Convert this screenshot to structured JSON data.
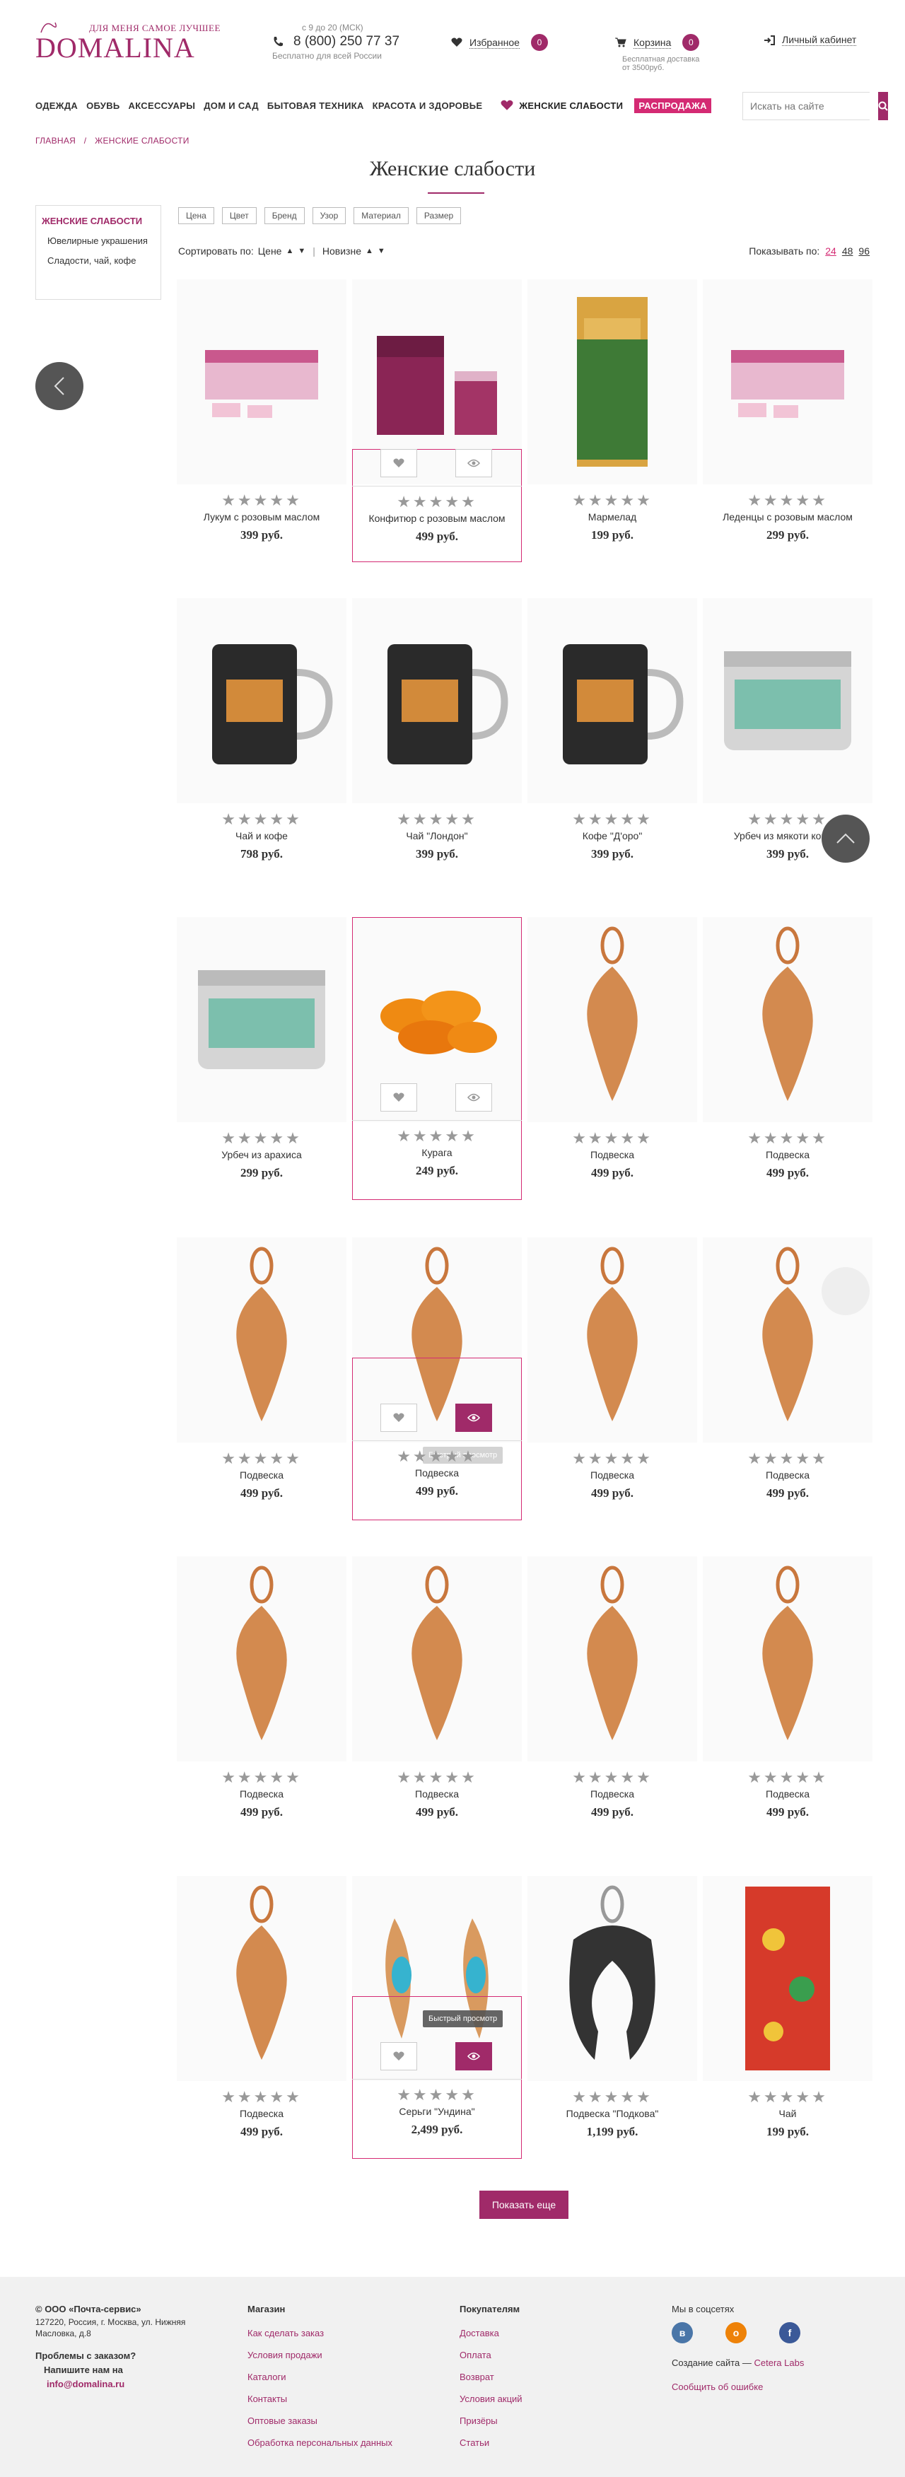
{
  "header": {
    "logo_tagline": "ДЛЯ МЕНЯ САМОЕ ЛУЧШЕЕ",
    "logo_text": "DOMALINA",
    "hours": "с 9 до 20 (МСК)",
    "phone": "8 (800) 250 77 37",
    "phone_sub": "Бесплатно для всей России",
    "favorites_label": "Избранное",
    "favorites_count": "0",
    "cart_label": "Корзина",
    "cart_count": "0",
    "cart_sub": "Бесплатная доставка от 3500руб.",
    "account_label": "Личный кабинет"
  },
  "nav": {
    "items": [
      "ОДЕЖДА",
      "ОБУВЬ",
      "АКСЕССУАРЫ",
      "ДОМ И САД",
      "БЫТОВАЯ ТЕХНИКА",
      "КРАСОТА И ЗДОРОВЬЕ"
    ],
    "women": "ЖЕНСКИЕ СЛАБОСТИ",
    "sale": "РАСПРОДАЖА",
    "search_placeholder": "Искать на сайте"
  },
  "breadcrumb": [
    "ГЛАВНАЯ",
    "/",
    "ЖЕНСКИЕ СЛАБОСТИ"
  ],
  "page_title": "Женские слабости",
  "sidebar": [
    "ЖЕНСКИЕ СЛАБОСТИ",
    "Ювелирные украшения",
    "Сладости, чай, кофе"
  ],
  "filters": [
    "Цена",
    "Цвет",
    "Бренд",
    "Узор",
    "Материал",
    "Размер"
  ],
  "sort": {
    "label": "Сортировать по:",
    "price": "Цене",
    "sep": "|",
    "new": "Новизне",
    "show_label": "Показывать по:",
    "options": [
      "24",
      "48",
      "96"
    ]
  },
  "stars": "★★★★★",
  "products": [
    {
      "name": "Лукум с розовым маслом",
      "price": "399 руб."
    },
    {
      "name": "Конфитюр с розовым маслом",
      "price": "499 руб."
    },
    {
      "name": "Мармелад",
      "price": "199 руб."
    },
    {
      "name": "Леденцы с розовым маслом",
      "price": "299 руб."
    },
    {
      "name": "Чай и кофе",
      "price": "798 руб."
    },
    {
      "name": "Чай \"Лондон\"",
      "price": "399 руб."
    },
    {
      "name": "Кофе \"Д'оро\"",
      "price": "399 руб."
    },
    {
      "name": "Урбеч из мякоти кокоса",
      "price": "399 руб."
    },
    {
      "name": "Урбеч из арахиса",
      "price": "299 руб."
    },
    {
      "name": "Курага",
      "price": "249 руб."
    },
    {
      "name": "Подвеска",
      "price": "499 руб."
    },
    {
      "name": "Подвеска",
      "price": "499 руб."
    },
    {
      "name": "Подвеска",
      "price": "499 руб."
    },
    {
      "name": "Подвеска",
      "price": "499 руб."
    },
    {
      "name": "Подвеска",
      "price": "499 руб."
    },
    {
      "name": "Подвеска",
      "price": "499 руб."
    },
    {
      "name": "Подвеска",
      "price": "499 руб."
    },
    {
      "name": "Подвеска",
      "price": "499 руб."
    },
    {
      "name": "Подвеска",
      "price": "499 руб."
    },
    {
      "name": "Подвеска",
      "price": "499 руб."
    },
    {
      "name": "Подвеска",
      "price": "499 руб."
    },
    {
      "name": "Серьги \"Ундина\"",
      "price": "2,499 руб."
    },
    {
      "name": "Подвеска \"Подкова\"",
      "price": "1,199 руб."
    },
    {
      "name": "Чай",
      "price": "199 руб."
    }
  ],
  "tooltip": "Быстрый просмотр",
  "show_more": "Показать еще",
  "footer": {
    "company": "© ООО «Почта-сервис»",
    "address": "127220, Россия, г. Москва, ул. Нижняя Масловка, д.8",
    "problems": "Проблемы с заказом?",
    "write": "Напишите нам на",
    "email": "info@domalina.ru",
    "shop_title": "Магазин",
    "shop_links": [
      "Как сделать заказ",
      "Условия продажи",
      "Каталоги",
      "Контакты",
      "Оптовые заказы",
      "Обработка персональных данных"
    ],
    "buyers_title": "Покупателям",
    "buyers_links": [
      "Доставка",
      "Оплата",
      "Возврат",
      "Условия акций",
      "Призёры",
      "Статьи"
    ],
    "social_title": "Мы в соцсетях",
    "social": [
      "vk-icon",
      "odnoklassniki-icon",
      "facebook-icon"
    ],
    "made_by": "Создание сайта — ",
    "made_by_link": "Cetera Labs",
    "report_error": "Сообщить об ошибке"
  },
  "colors": {
    "brand": "#a02a69",
    "sale": "#d42a73"
  }
}
